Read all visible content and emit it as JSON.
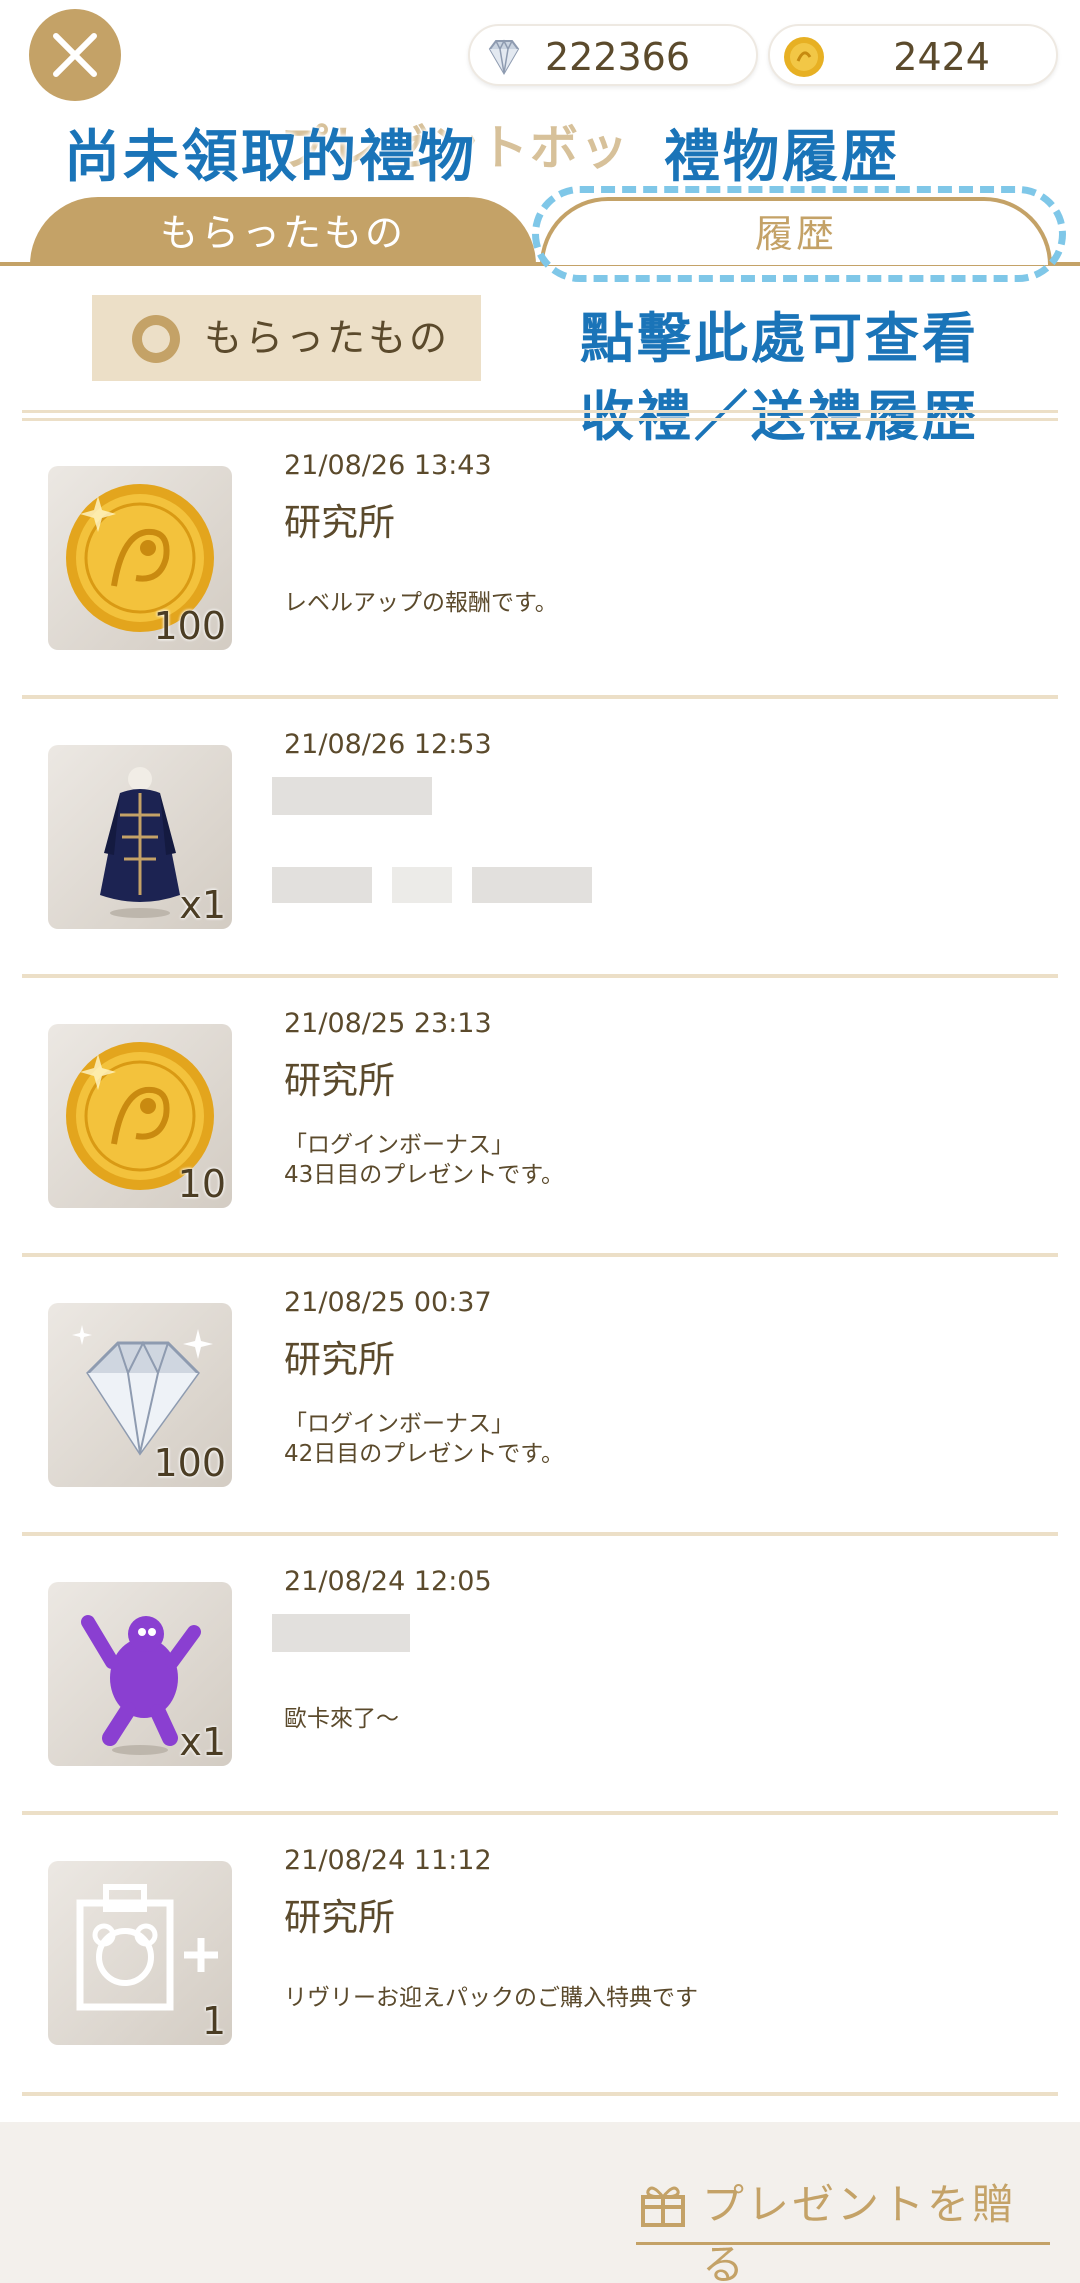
{
  "header": {
    "gems": "222366",
    "coins": "2424"
  },
  "annotation": {
    "title_left": "尚未領取的禮物",
    "title_right": "禮物履歴",
    "title_ghost": "プレゼントボッ",
    "note_line1": "點擊此處可查看",
    "note_line2": "收禮／送禮履歴"
  },
  "tabs": {
    "received": "もらったもの",
    "history": "履歴"
  },
  "filter": {
    "label": "もらったもの"
  },
  "items": [
    {
      "date": "21/08/26 13:43",
      "sender": "研究所",
      "message": "レベルアップの報酬です。",
      "qty": "100",
      "icon": "gold-coin-icon"
    },
    {
      "date": "21/08/26 12:53",
      "sender": "",
      "message": "",
      "qty": "x1",
      "icon": "costume-icon"
    },
    {
      "date": "21/08/25 23:13",
      "sender": "研究所",
      "message": "「ログインボーナス」\n43日目のプレゼントです。",
      "qty": "10",
      "icon": "gold-coin-icon"
    },
    {
      "date": "21/08/25 00:37",
      "sender": "研究所",
      "message": "「ログインボーナス」\n42日目のプレゼントです。",
      "qty": "100",
      "icon": "diamond-icon"
    },
    {
      "date": "21/08/24 12:05",
      "sender": "",
      "message": "歐卡來了〜",
      "qty": "x1",
      "icon": "purple-monster-icon"
    },
    {
      "date": "21/08/24 11:12",
      "sender": "研究所",
      "message": "リヴリーお迎えパックのご購入特典です",
      "qty": "1",
      "icon": "gift-pack-icon"
    }
  ],
  "footer": {
    "send_label": "プレゼントを贈る"
  },
  "colors": {
    "accent": "#c4a267",
    "annotation": "#1a74b8",
    "highlight": "#7fc7e8"
  }
}
